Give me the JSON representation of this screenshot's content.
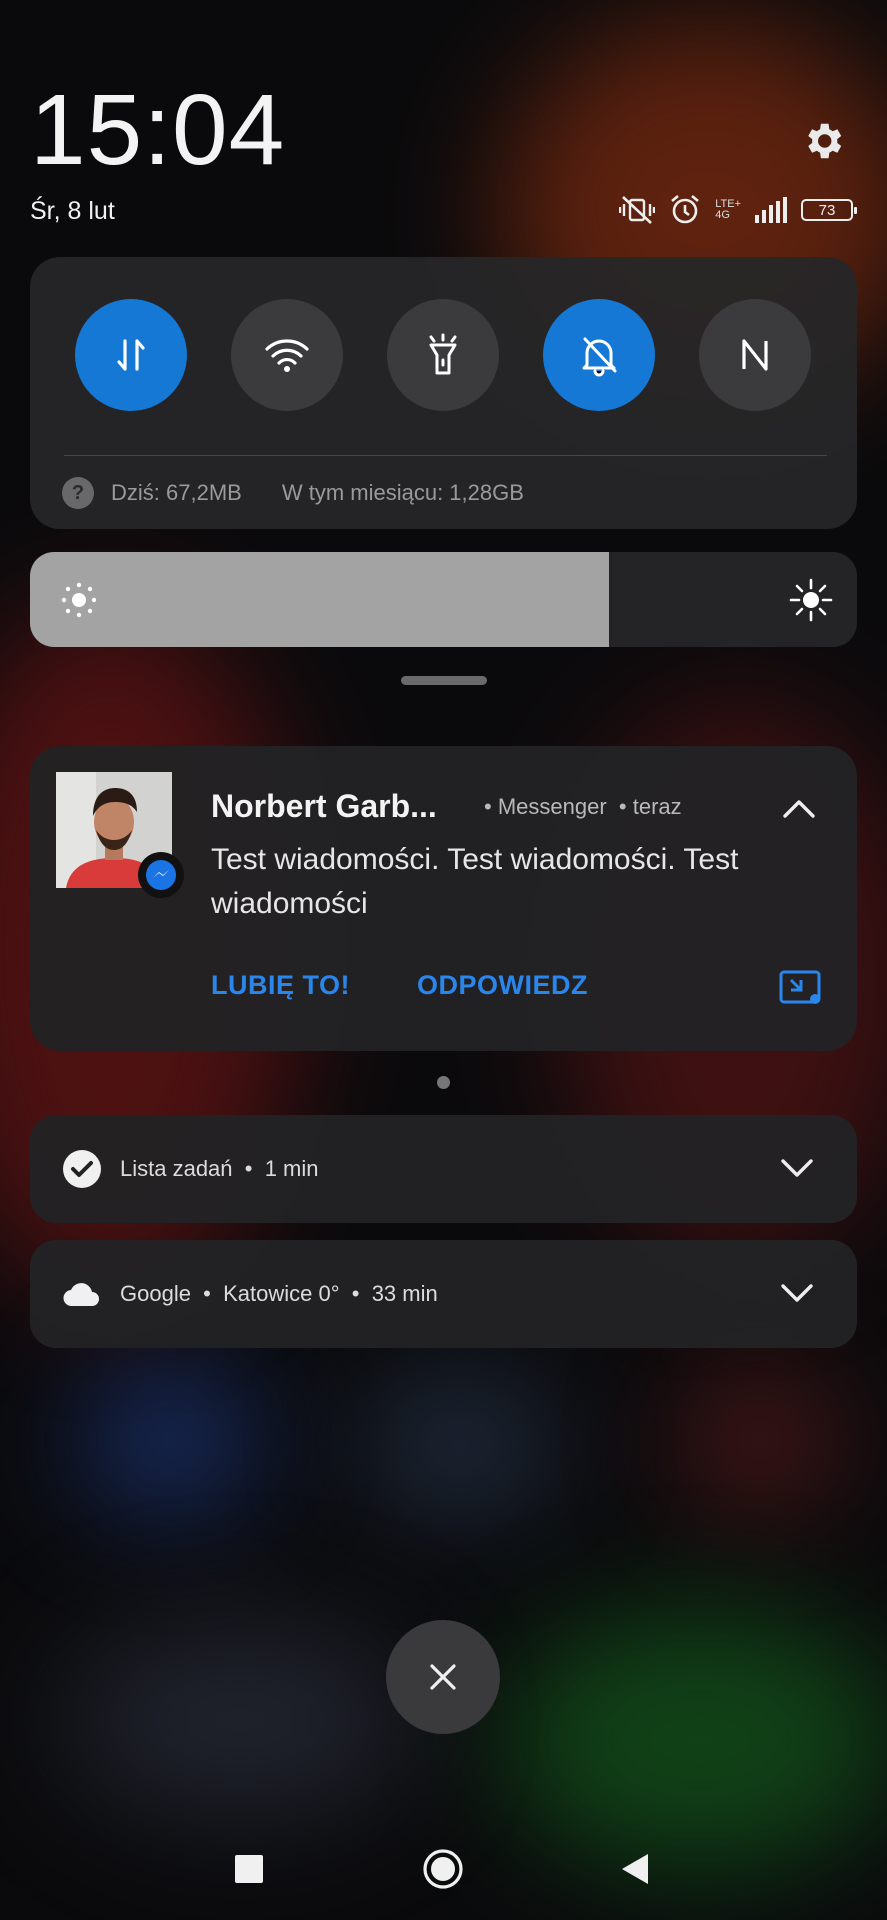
{
  "header": {
    "time": "15:04",
    "date": "Śr, 8 lut"
  },
  "status_bar": {
    "network_label_top": "LTE+",
    "network_label_bottom": "4G",
    "battery": "73"
  },
  "quick_settings": {
    "tiles": [
      {
        "name": "mobile-data",
        "icon": "data-transfer-icon",
        "active": true
      },
      {
        "name": "wifi",
        "icon": "wifi-icon",
        "active": false
      },
      {
        "name": "flashlight",
        "icon": "flashlight-icon",
        "active": false
      },
      {
        "name": "silent",
        "icon": "bell-off-icon",
        "active": true
      },
      {
        "name": "nfc",
        "icon": "nfc-icon",
        "active": false
      }
    ],
    "data_today": "Dziś: 67,2MB",
    "data_month": "W tym miesiącu: 1,28GB"
  },
  "brightness": {
    "level": 0.7
  },
  "notification": {
    "sender": "Norbert Garb...",
    "app": "Messenger",
    "time": "teraz",
    "message": "Test wiadomości. Test wiadomości. Test wiadomości",
    "actions": {
      "like": "LUBIĘ TO!",
      "reply": "ODPOWIEDZ"
    }
  },
  "cards": [
    {
      "title": "Lista zadań",
      "time": "1 min"
    },
    {
      "title": "Google",
      "location": "Katowice 0°",
      "time": "33 min"
    }
  ],
  "colors": {
    "accent": "#1478d4",
    "action_text": "#2b86ec"
  }
}
